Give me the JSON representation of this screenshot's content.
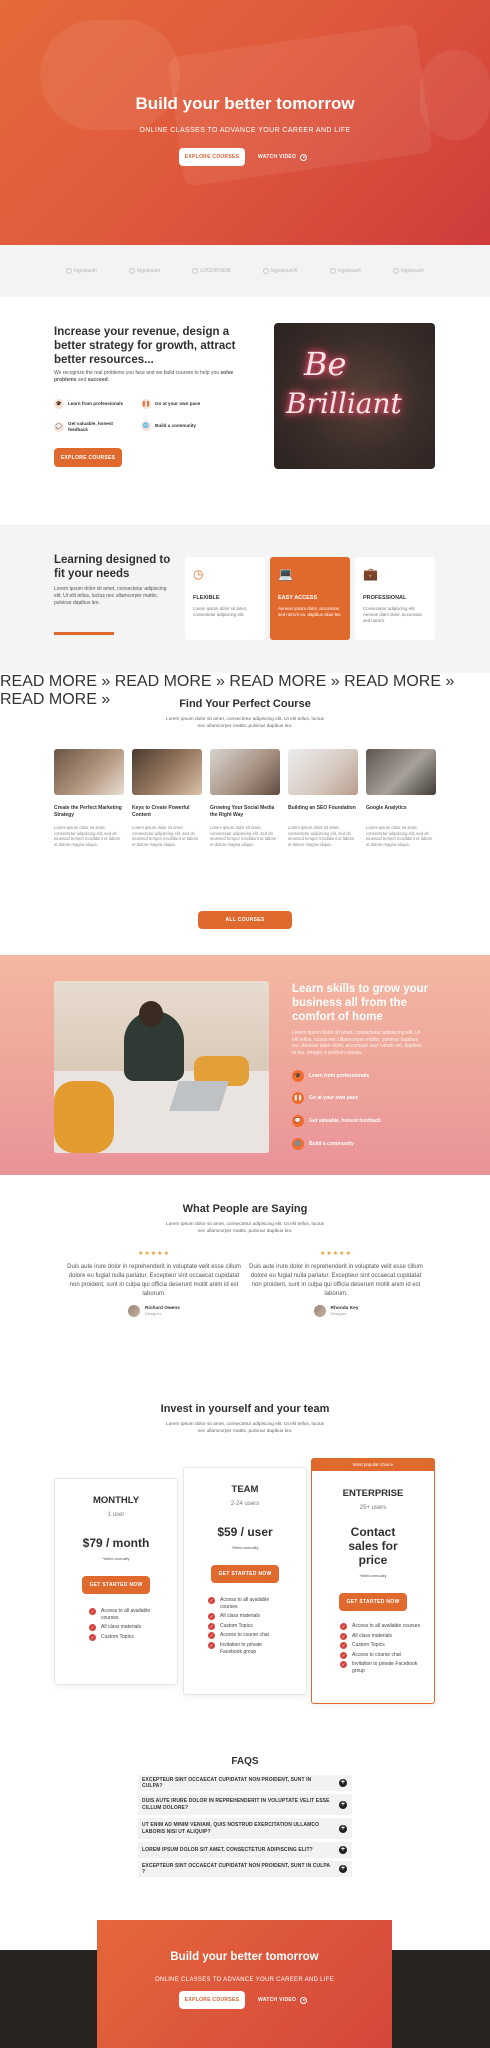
{
  "hero": {
    "title": "Build your better tomorrow",
    "subtitle": "ONLINE CLASSES TO ADVANCE YOUR CAREER AND LIFE",
    "primary_button": "EXPLORE COURSES",
    "secondary_button": "WATCH VIDEO"
  },
  "logos": [
    "logoipsum",
    "logoipsum",
    "LOGOIPSUM",
    "logoipsum®",
    "logoipsum",
    "logoipsum"
  ],
  "about": {
    "title": "Increase your revenue, design a better strategy for growth, attract better resources...",
    "text_start": "We recognize the real problems you face and we build courses to help you ",
    "text_strong1": "solve problems",
    "text_mid": " and ",
    "text_strong2": "succeed",
    "text_end": ".",
    "features": [
      {
        "label": "Learn from professionals",
        "icon": "graduation-icon"
      },
      {
        "label": "Go at your own pace",
        "icon": "pause-icon"
      },
      {
        "label": "Get valuable, honest feedback",
        "icon": "chat-icon"
      },
      {
        "label": "Build a community",
        "icon": "globe-icon"
      }
    ],
    "button": "EXPLORE COURSES",
    "neon_line1": "Be",
    "neon_line2": "Brilliant"
  },
  "learning": {
    "title": "Learning designed to fit your needs",
    "text": "Lorem ipsum dolor sit amet, consectetur adipiscing elit. Ut elit tellus, luctus nec ullamcorper mattis, pulvinar dapibus leo.",
    "cards": [
      {
        "title": "FLEXIBLE",
        "text": "Lorem ipsum dolor sit amet, consectetur adipiscing elit.",
        "icon": "clock-icon"
      },
      {
        "title": "EASY ACCESS",
        "text": "Aenean ipsum dolor, accumsan sed rutrum eu, dapibus vitae leo.",
        "icon": "laptop-icon"
      },
      {
        "title": "PROFESSIONAL",
        "text": "Consectetur adipiscing elit, Aenean diam dolor, accumsan sed rutrum.",
        "icon": "briefcase-icon"
      }
    ]
  },
  "courses": {
    "title": "Find Your Perfect Course",
    "text": "Lorem ipsum dolor sit amet, consectetur adipiscing elit. Ut elit tellus, luctus nec ullamcorper mattis, pulvinar dapibus leo.",
    "items": [
      {
        "title": "Create the Perfect Marketing Strategy",
        "text": "Lorem ipsum dolor sit amet, consectetur adipiscing elit, sed do eiusmod tempor incididunt ut labore et dolore magna aliqua.",
        "link": "READ MORE »"
      },
      {
        "title": "Keys to Create Powerful Content",
        "text": "Lorem ipsum dolor sit amet, consectetur adipiscing elit, sed do eiusmod tempor incididunt ut labore et dolore magna aliqua.",
        "link": "READ MORE »"
      },
      {
        "title": "Growing Your Social Media the Right Way",
        "text": "Lorem ipsum dolor sit amet, consectetur adipiscing elit, sed do eiusmod tempor incididunt ut labore et dolore magna aliqua.",
        "link": "READ MORE »"
      },
      {
        "title": "Building an SEO Foundation",
        "text": "Lorem ipsum dolor sit amet, consectetur adipiscing elit, sed do eiusmod tempor incididunt ut labore et dolore magna aliqua.",
        "link": "READ MORE »"
      },
      {
        "title": "Google Analytics",
        "text": "Lorem ipsum dolor sit amet, consectetur adipiscing elit, sed do eiusmod tempor incididunt ut labore et dolore magna aliqua.",
        "link": "READ MORE »"
      }
    ],
    "button": "ALL COURSES"
  },
  "skills": {
    "title": "Learn skills to grow your business all from the comfort of home",
    "text": "Lorem ipsum dolor sit amet, consectetur adipiscing elit. Ut elit tellus, luctus nec ullamcorper mattis, pulvinar dapibus leo. Aenean diam dolor, accumsan sed rutrum vel, dapibus et leo. Integer a pretium massa.",
    "features": [
      {
        "label": "Learn from professionals",
        "icon": "graduation-icon"
      },
      {
        "label": "Go at your own pace",
        "icon": "pause-icon"
      },
      {
        "label": "Get valuable, honest feedback",
        "icon": "chat-icon"
      },
      {
        "label": "Build a community",
        "icon": "globe-icon"
      }
    ]
  },
  "testimonials": {
    "title": "What People are Saying",
    "text": "Lorem ipsum dolor sit amet, consectetur adipiscing elit. Ut elit tellus, luctus nec ullamcorper mattis, pulvinar dapibus leo.",
    "items": [
      {
        "stars": "★★★★★",
        "quote": "Duis aute irure dolor in reprehenderit in voluptate velit esse cillum dolore eu fugiat nulla pariatur. Excepteur sint occaecat cupidatat non proident, sunt in culpa qui officia deserunt mollit anim id est laborum.",
        "name": "Richard Owens",
        "role": "Designer"
      },
      {
        "stars": "★★★★★",
        "quote": "Duis aute irure dolor in reprehenderit in voluptate velit esse cillum dolore eu fugiat nulla pariatur. Excepteur sint occaecat cupidatat non proident, sunt in culpa qui officia deserunt mollit anim id est laborum.",
        "name": "Rhonda Key",
        "role": "Designer"
      }
    ]
  },
  "pricing": {
    "title": "Invest in yourself and your team",
    "text": "Lorem ipsum dolor sit amet, consectetur adipiscing elit. Ut elit tellus, luctus nec ullamcorper mattis, pulvinar dapibus leo.",
    "plans": [
      {
        "name": "MONTHLY",
        "users": "1 user",
        "price": "$79 / month",
        "billing": "*billed annually",
        "button": "GET STARTED NOW",
        "features": [
          "Access to all available courses",
          "All class materials",
          "Custom Topics"
        ]
      },
      {
        "name": "TEAM",
        "users": "2-24 users",
        "price": "$59 / user",
        "billing": "*billed annually",
        "button": "GET STARTED NOW",
        "features": [
          "Access to all available courses",
          "All class materials",
          "Custom Topics",
          "Access to course chat",
          "Invitation to private Facebook group"
        ]
      },
      {
        "ribbon": "Most popular choice",
        "name": "ENTERPRISE",
        "users": "25+ users",
        "price": "Contact sales for price",
        "billing": "*billed annually",
        "button": "GET STARTED NOW",
        "features": [
          "Access to all available courses",
          "All class materials",
          "Custom Topics",
          "Access to course chat",
          "Invitation to private Facebook group"
        ]
      }
    ]
  },
  "faq": {
    "title": "FAQS",
    "items": [
      "EXCEPTEUR SINT OCCAECAT CUPIDATAT NON PROIDENT, SUNT IN CULPA?",
      "DUIS AUTE IRURE DOLOR IN REPREHENDERIT IN VOLUPTATE VELIT ESSE CILLUM DOLORE?",
      "UT ENIM AD MINIM VENIAM, QUIS NOSTRUD EXERCITATION ULLAMCO LABORIS NISI UT ALIQUIP?",
      "LOREM IPSUM DOLOR SIT AMET, CONSECTETUR ADIPISCING ELIT?",
      "EXCEPTEUR SINT OCCAECAT CUPIDATAT NON PROIDENT, SUNT IN CULPA ?"
    ]
  },
  "cta": {
    "title": "Build your better tomorrow",
    "subtitle": "ONLINE CLASSES TO ADVANCE YOUR CAREER AND LIFE",
    "primary_button": "EXPLORE COURSES",
    "secondary_button": "WATCH VIDEO"
  },
  "colors": {
    "accent": "#e06a2e",
    "hero_start": "#e36a3a",
    "hero_end": "#cf3c3c",
    "dark_footer": "#2a2420"
  }
}
